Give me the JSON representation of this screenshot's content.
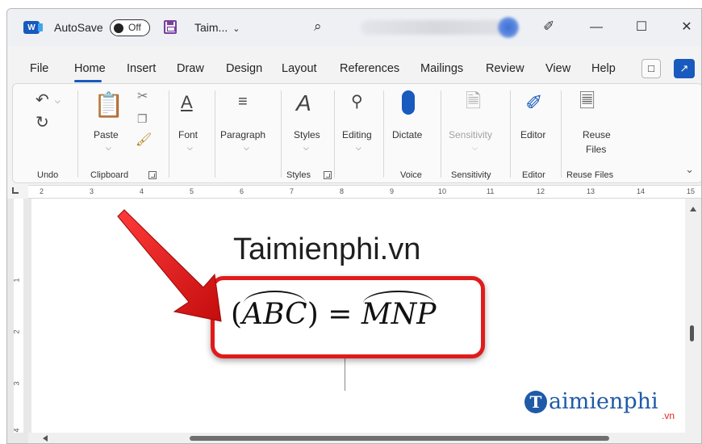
{
  "titlebar": {
    "app_icon": "word-icon",
    "app_icon_letter": "W",
    "autosave_label": "AutoSave",
    "autosave_state": "Off",
    "document_name": "Taim...",
    "doc_chevron": "⌄",
    "search_icon": "⌕",
    "pen_icon": "✐",
    "minimize": "—",
    "maximize": "☐",
    "close": "✕"
  },
  "tabs": [
    "File",
    "Home",
    "Insert",
    "Draw",
    "Design",
    "Layout",
    "References",
    "Mailings",
    "Review",
    "View",
    "Help"
  ],
  "active_tab": "Home",
  "ribbon": {
    "undo_group": "Undo",
    "clipboard": {
      "paste": "Paste",
      "group": "Clipboard"
    },
    "font": {
      "label": "Font"
    },
    "paragraph": {
      "label": "Paragraph"
    },
    "styles": {
      "label": "Styles",
      "group": "Styles"
    },
    "editing": {
      "label": "Editing"
    },
    "voice": {
      "label": "Dictate",
      "group": "Voice"
    },
    "sensitivity": {
      "label": "Sensitivity",
      "group": "Sensitivity"
    },
    "editor": {
      "label": "Editor",
      "group": "Editor"
    },
    "reuse": {
      "label_line1": "Reuse",
      "label_line2": "Files",
      "group": "Reuse Files"
    }
  },
  "ruler": [
    "2",
    "3",
    "4",
    "5",
    "6",
    "7",
    "8",
    "9",
    "10",
    "11",
    "12",
    "13",
    "14",
    "15"
  ],
  "vertical_ruler": [
    "1",
    "2",
    "3",
    "4"
  ],
  "document": {
    "site_title": "Taimienphi.vn",
    "formula": {
      "open": "(",
      "left_arc": "ABC",
      "close": ")",
      "equals": " = ",
      "right_arc": "MNP"
    }
  },
  "watermark": {
    "letter": "T",
    "text": "aimienphi",
    "suffix": ".vn"
  },
  "colors": {
    "accent": "#185abd",
    "highlight_border": "#e01b1b",
    "arrow": "#e01b1b"
  }
}
